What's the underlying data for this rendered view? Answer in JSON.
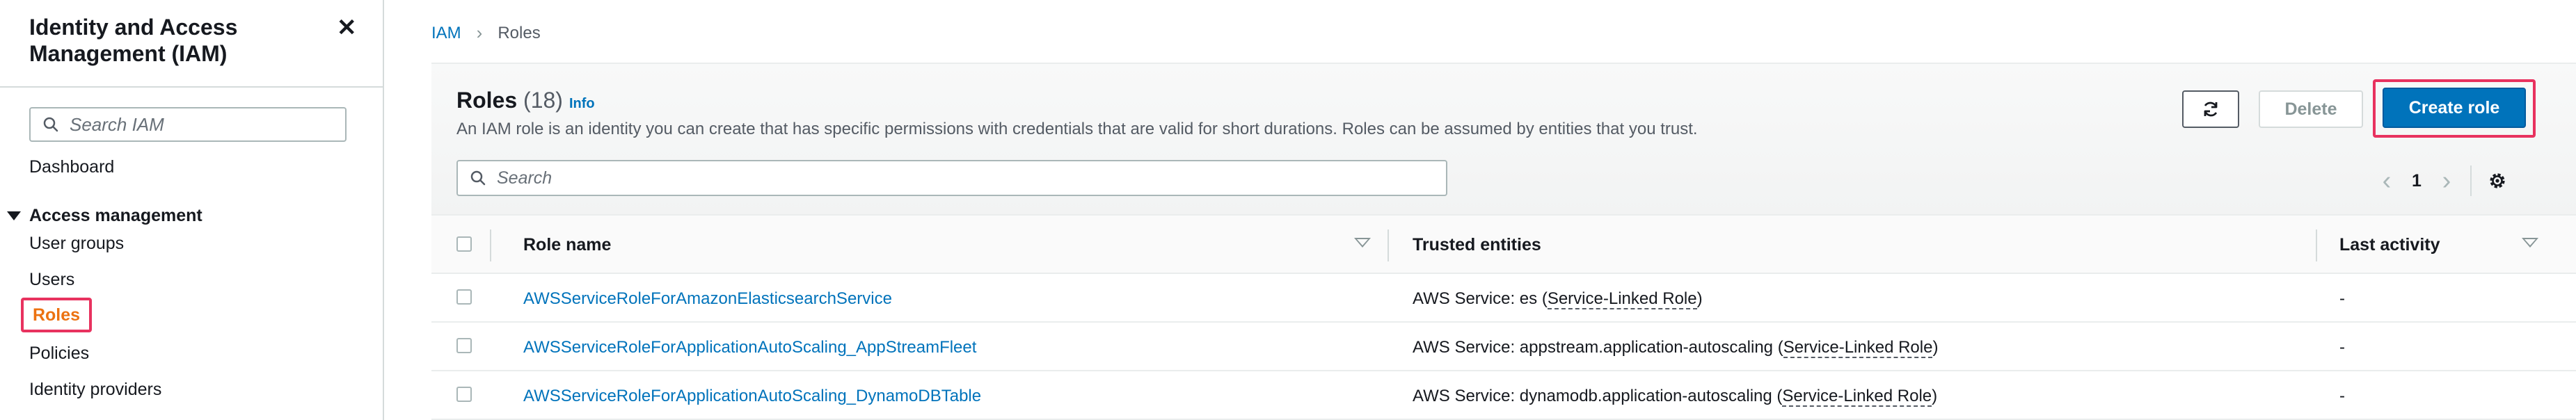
{
  "sidebar": {
    "title": "Identity and Access Management (IAM)",
    "close_icon": "close-icon",
    "search_placeholder": "Search IAM",
    "dashboard": "Dashboard",
    "section": "Access management",
    "items": [
      {
        "label": "User groups"
      },
      {
        "label": "Users"
      },
      {
        "label": "Roles",
        "active": true
      },
      {
        "label": "Policies"
      },
      {
        "label": "Identity providers"
      }
    ]
  },
  "breadcrumb": {
    "root": "IAM",
    "current": "Roles"
  },
  "header": {
    "title": "Roles",
    "count": "(18)",
    "info": "Info",
    "description": "An IAM role is an identity you can create that has specific permissions with credentials that are valid for short durations. Roles can be assumed by entities that you trust.",
    "delete_label": "Delete",
    "create_label": "Create role",
    "search_placeholder": "Search",
    "page": "1"
  },
  "table": {
    "columns": {
      "name": "Role name",
      "trusted": "Trusted entities",
      "activity": "Last activity"
    },
    "rows": [
      {
        "name": "AWSServiceRoleForAmazonElasticsearchService",
        "trusted_prefix": "AWS Service: es (",
        "trusted_link": "Service-Linked Role",
        "trusted_suffix": ")",
        "activity": "-"
      },
      {
        "name": "AWSServiceRoleForApplicationAutoScaling_AppStreamFleet",
        "trusted_prefix": "AWS Service: appstream.application-autoscaling (",
        "trusted_link": "Service-Linked Role",
        "trusted_suffix": ")",
        "activity": "-"
      },
      {
        "name": "AWSServiceRoleForApplicationAutoScaling_DynamoDBTable",
        "trusted_prefix": "AWS Service: dynamodb.application-autoscaling (",
        "trusted_link": "Service-Linked Role",
        "trusted_suffix": ")",
        "activity": "-"
      }
    ]
  },
  "colors": {
    "accent": "#0073bb",
    "active_nav": "#ec7211",
    "highlight": "#e8325f"
  }
}
